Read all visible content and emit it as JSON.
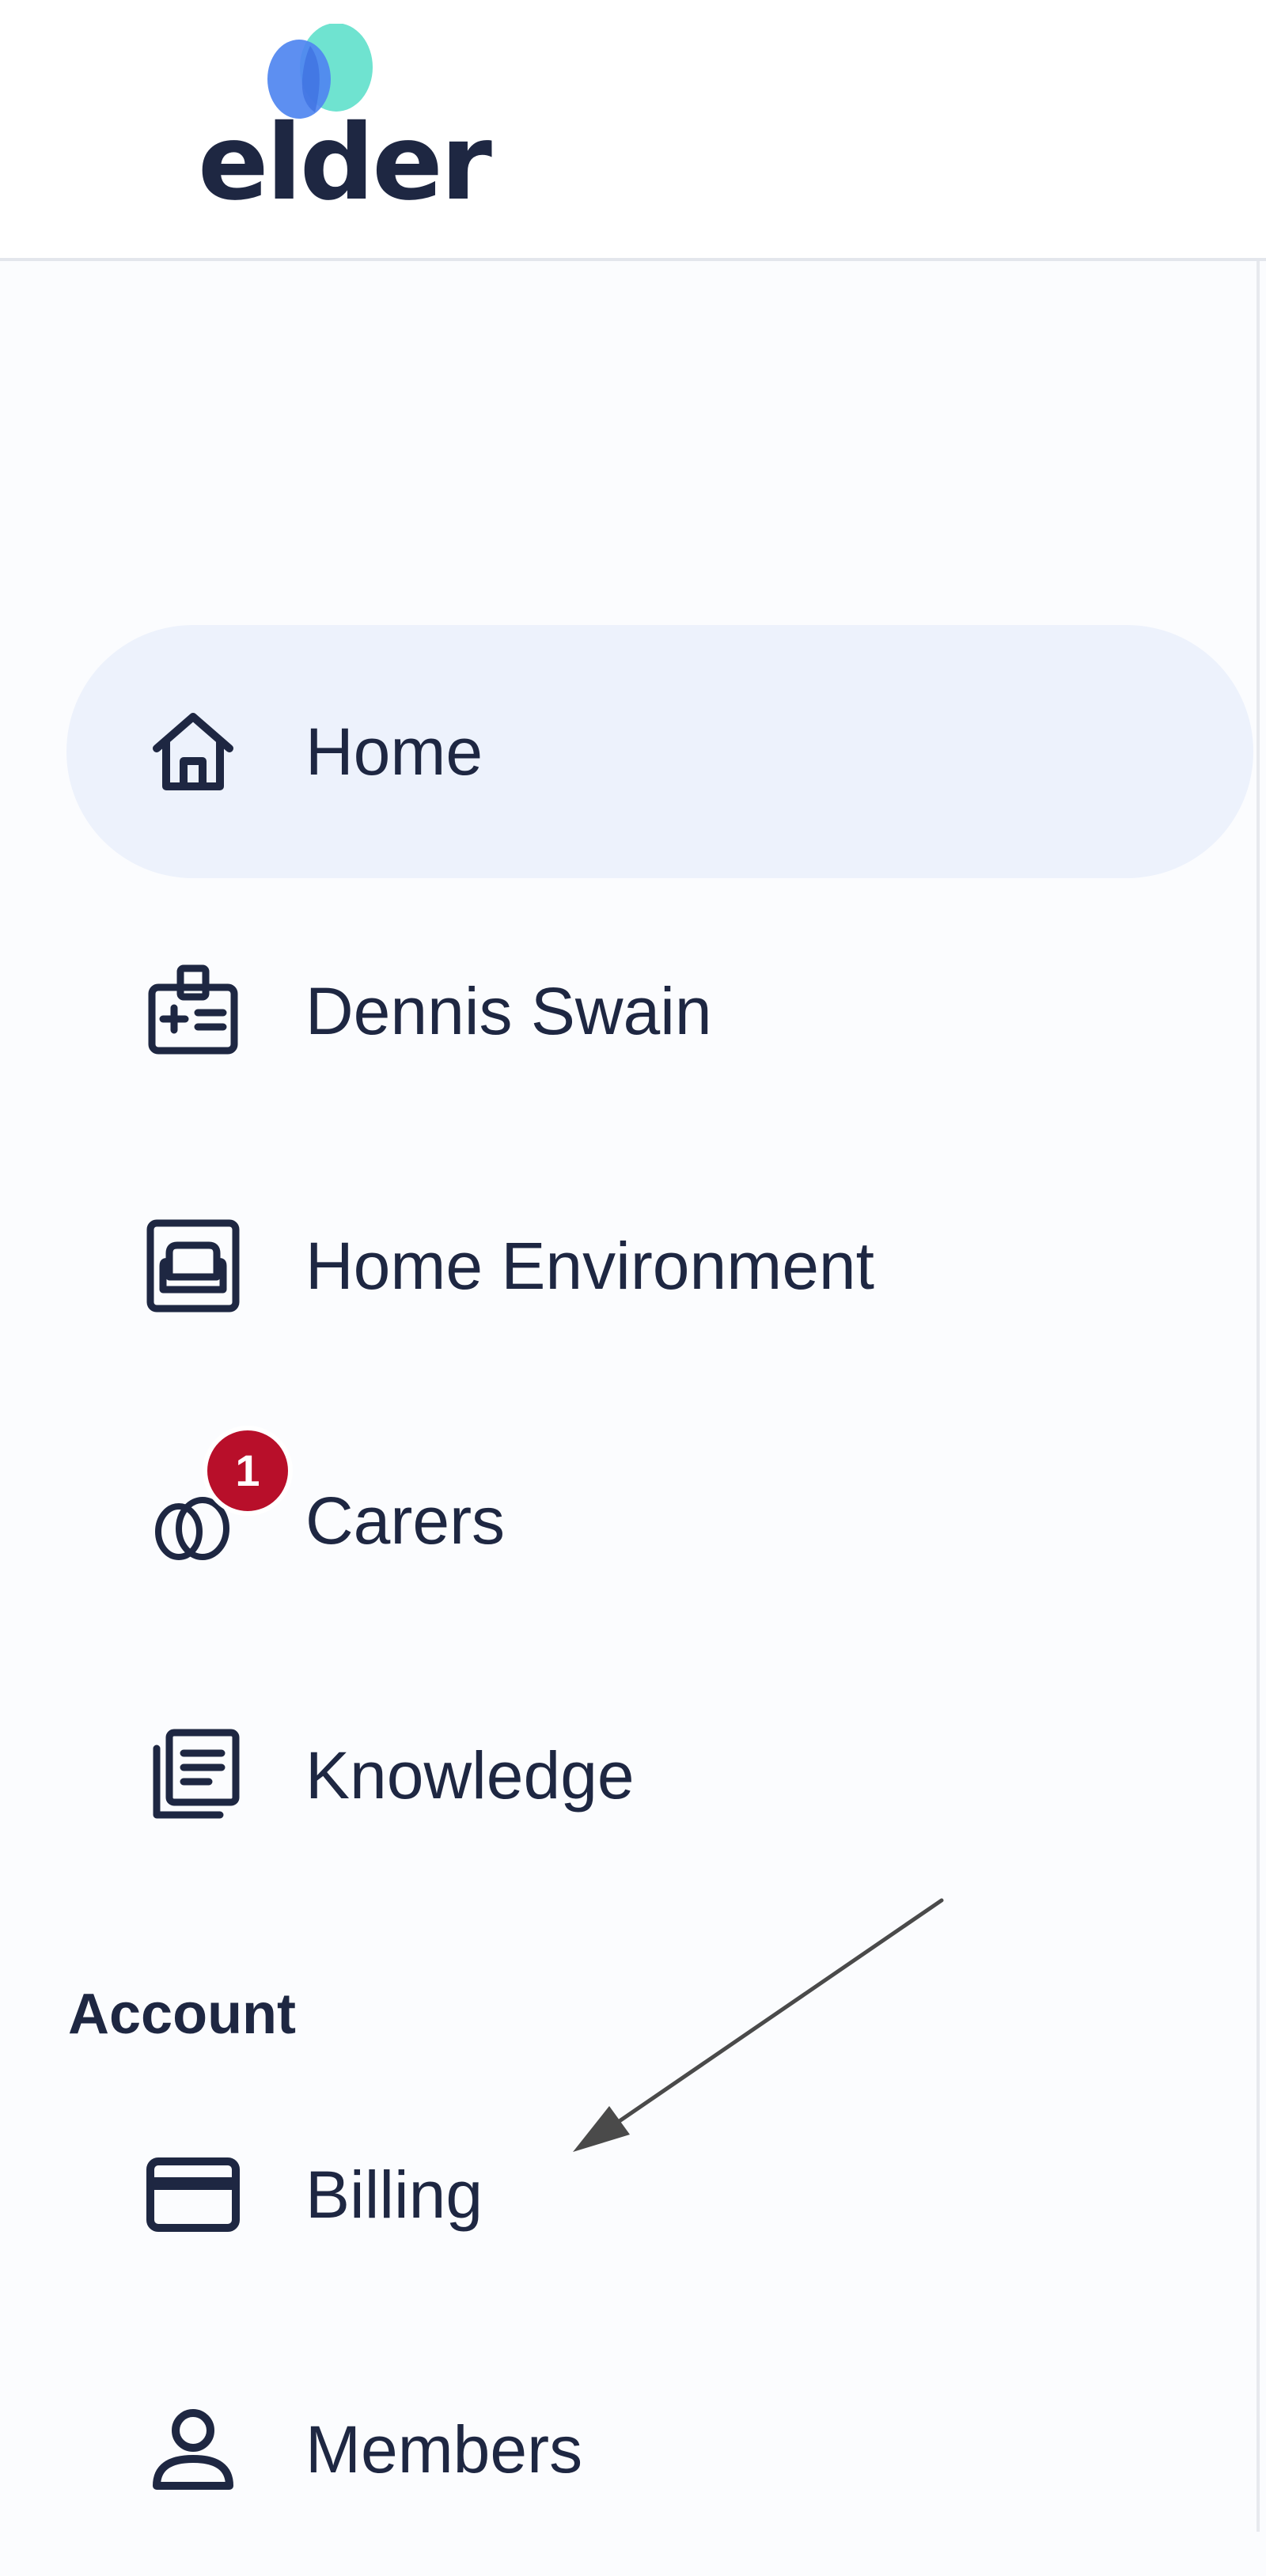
{
  "app": {
    "logo_text": "elder"
  },
  "colors": {
    "text": "#1e2742",
    "active_bg": "#edf2fc",
    "badge": "#b80f2a",
    "logo_blue": "#4f86f0",
    "logo_teal": "#6fe3d0"
  },
  "sidebar": {
    "items": [
      {
        "label": "Home",
        "icon": "home-icon",
        "active": true
      },
      {
        "label": "Dennis Swain",
        "icon": "id-badge-icon",
        "active": false
      },
      {
        "label": "Home Environment",
        "icon": "sofa-icon",
        "active": false
      },
      {
        "label": "Carers",
        "icon": "carers-icon",
        "active": false,
        "badge": "1"
      },
      {
        "label": "Knowledge",
        "icon": "documents-icon",
        "active": false
      }
    ],
    "account": {
      "heading": "Account",
      "items": [
        {
          "label": "Billing",
          "icon": "credit-card-icon"
        },
        {
          "label": "Members",
          "icon": "person-icon"
        }
      ]
    }
  }
}
